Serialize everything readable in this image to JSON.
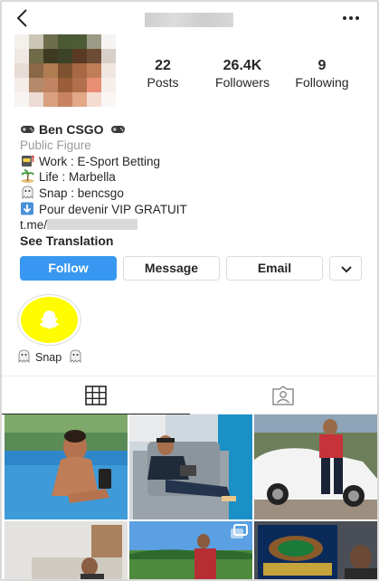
{
  "header": {
    "back_icon": "chevron-left-icon",
    "more_icon": "more-dots-icon"
  },
  "stats": {
    "posts": {
      "value": "22",
      "label": "Posts"
    },
    "followers": {
      "value": "26.4K",
      "label": "Followers"
    },
    "following": {
      "value": "9",
      "label": "Following"
    }
  },
  "bio": {
    "name": "Ben CSGO",
    "category": "Public Figure",
    "lines": [
      "Work : E-Sport Betting",
      "Life : Marbella",
      "Snap : bencsgo",
      "Pour devenir VIP GRATUIT"
    ],
    "link_prefix": "t.me/",
    "see_translation": "See Translation"
  },
  "buttons": {
    "follow": "Follow",
    "message": "Message",
    "email": "Email"
  },
  "highlight": {
    "label": "Snap"
  },
  "colors": {
    "follow_blue": "#3897f0",
    "snap_yellow": "#fffc00"
  }
}
